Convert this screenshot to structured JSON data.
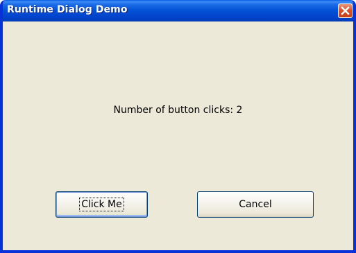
{
  "window": {
    "title": "Runtime Dialog Demo"
  },
  "icons": {
    "close": "close-icon"
  },
  "colors": {
    "titlebar": "#0555d8",
    "frame": "#0831d9",
    "dialog_bg": "#ece9d8",
    "close_button": "#d9542b"
  },
  "content": {
    "message": "Number of button clicks: 2"
  },
  "buttons": {
    "click_me_label": "Click Me",
    "cancel_label": "Cancel"
  }
}
